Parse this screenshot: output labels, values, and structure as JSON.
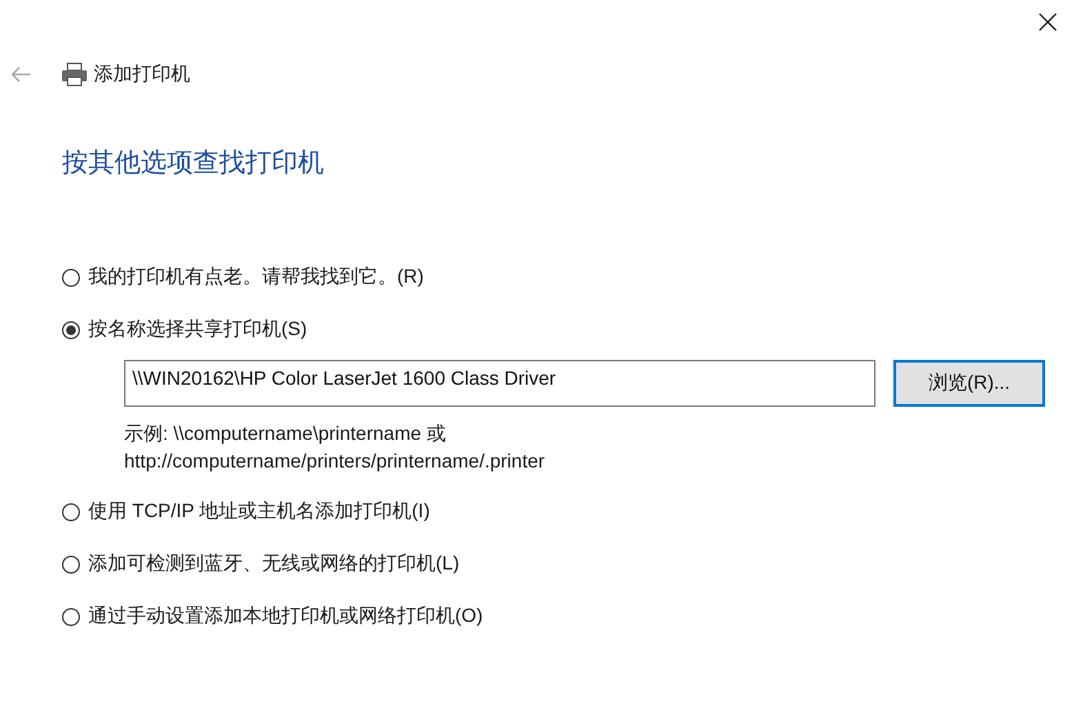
{
  "window": {
    "title": "添加打印机"
  },
  "heading": "按其他选项查找打印机",
  "options": [
    {
      "kind": "plain",
      "label": "我的打印机有点老。请帮我找到它。(R)",
      "selected": false
    },
    {
      "kind": "with_path",
      "label": "按名称选择共享打印机(S)",
      "selected": true,
      "value": "\\\\WIN20162\\HP Color LaserJet 1600 Class Driver",
      "browse": "浏览(R)...",
      "hint": [
        "示例: \\\\computername\\printername 或",
        "http://computername/printers/printername/.printer"
      ]
    },
    {
      "kind": "plain",
      "label": "使用 TCP/IP 地址或主机名添加打印机(I)",
      "selected": false
    },
    {
      "kind": "plain",
      "label": "添加可检测到蓝牙、无线或网络的打印机(L)",
      "selected": false
    },
    {
      "kind": "plain",
      "label": "通过手动设置添加本地打印机或网络打印机(O)",
      "selected": false
    }
  ]
}
